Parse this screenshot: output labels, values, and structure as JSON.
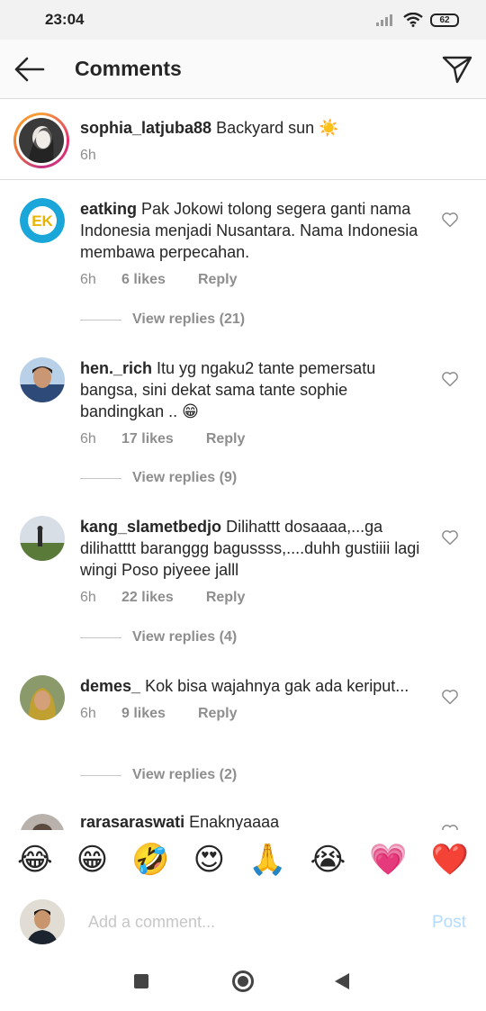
{
  "status_bar": {
    "time": "23:04",
    "battery": "62"
  },
  "header": {
    "title": "Comments"
  },
  "caption": {
    "username": "sophia_latjuba88",
    "text": "Backyard sun",
    "emoji": "☀️",
    "time": "6h"
  },
  "comments": [
    {
      "username": "eatking",
      "text": "Pak Jokowi tolong segera ganti nama Indonesia menjadi Nusantara. Nama Indonesia membawa perpecahan.",
      "time": "6h",
      "likes": "6 likes",
      "reply": "Reply",
      "view_replies": "View replies (21)"
    },
    {
      "username": "hen._rich",
      "text": "Itu yg ngaku2 tante pemersatu bangsa, sini dekat sama tante sophie bandingkan .. 😁",
      "time": "6h",
      "likes": "17 likes",
      "reply": "Reply",
      "view_replies": "View replies (9)"
    },
    {
      "username": "kang_slametbedjo",
      "text": "Dilihattt dosaaaa,...ga dilihatttt baranggg bagussss,....duhh gustiiii lagi wingi Poso piyeee jalll",
      "time": "6h",
      "likes": "22 likes",
      "reply": "Reply",
      "view_replies": "View replies (4)"
    },
    {
      "username": "demes_",
      "text": "Kok bisa wajahnya gak ada keriput...",
      "time": "6h",
      "likes": "9 likes",
      "reply": "Reply",
      "view_replies": "View replies (2)"
    },
    {
      "username": "rarasaraswati",
      "text": "Enaknyaaaa"
    }
  ],
  "emoji_bar": [
    "😂",
    "😁",
    "🤣",
    "😍",
    "🙏",
    "😭",
    "💗",
    "❤️"
  ],
  "add_comment": {
    "placeholder": "Add a comment...",
    "post_label": "Post"
  },
  "colors": {
    "link_disabled": "#b3dbff",
    "meta_gray": "#8e8e8e",
    "heart_red": "#ed4956"
  }
}
